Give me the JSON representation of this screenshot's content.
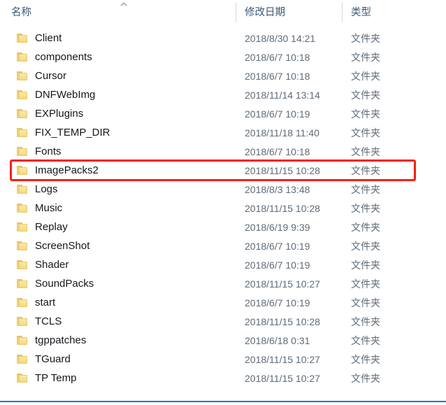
{
  "window": {
    "kind": "file-explorer-list-view"
  },
  "header": {
    "columns": [
      {
        "key": "name",
        "label": "名称"
      },
      {
        "key": "date",
        "label": "修改日期"
      },
      {
        "key": "type",
        "label": "类型"
      }
    ],
    "sort": {
      "column": "名称",
      "direction": "ascending",
      "indicator_glyph": "︿"
    }
  },
  "icons": {
    "folder": "folder-icon",
    "sort_ascending": "sort-ascending-icon"
  },
  "annotation": {
    "shape": "rectangle",
    "color": "#fa1e0e",
    "targets_row": "ImagePacks2"
  },
  "colors": {
    "header_text": "#3c5a78",
    "name_text": "#14181c",
    "meta_text": "#5f6b77",
    "folder_fill": "#f6dd8e",
    "annotation": "#fa1e0e",
    "bottom_rule": "#1578bf",
    "column_divider": "#d9d9d9"
  },
  "rows": [
    {
      "name": "Client",
      "date": "2018/8/30 14:21",
      "type": "文件夹",
      "icon": "folder-icon",
      "highlighted": false
    },
    {
      "name": "components",
      "date": "2018/6/7 10:18",
      "type": "文件夹",
      "icon": "folder-icon",
      "highlighted": false
    },
    {
      "name": "Cursor",
      "date": "2018/6/7 10:18",
      "type": "文件夹",
      "icon": "folder-icon",
      "highlighted": false
    },
    {
      "name": "DNFWebImg",
      "date": "2018/11/14 13:14",
      "type": "文件夹",
      "icon": "folder-icon",
      "highlighted": false
    },
    {
      "name": "EXPlugins",
      "date": "2018/6/7 10:19",
      "type": "文件夹",
      "icon": "folder-icon",
      "highlighted": false
    },
    {
      "name": "FIX_TEMP_DIR",
      "date": "2018/11/18 11:40",
      "type": "文件夹",
      "icon": "folder-icon",
      "highlighted": false
    },
    {
      "name": "Fonts",
      "date": "2018/6/7 10:18",
      "type": "文件夹",
      "icon": "folder-icon",
      "highlighted": false
    },
    {
      "name": "ImagePacks2",
      "date": "2018/11/15 10:28",
      "type": "文件夹",
      "icon": "folder-icon",
      "highlighted": true
    },
    {
      "name": "Logs",
      "date": "2018/8/3 13:48",
      "type": "文件夹",
      "icon": "folder-icon",
      "highlighted": false
    },
    {
      "name": "Music",
      "date": "2018/11/15 10:28",
      "type": "文件夹",
      "icon": "folder-icon",
      "highlighted": false
    },
    {
      "name": "Replay",
      "date": "2018/6/19 9:39",
      "type": "文件夹",
      "icon": "folder-icon",
      "highlighted": false
    },
    {
      "name": "ScreenShot",
      "date": "2018/6/7 10:19",
      "type": "文件夹",
      "icon": "folder-icon",
      "highlighted": false
    },
    {
      "name": "Shader",
      "date": "2018/6/7 10:19",
      "type": "文件夹",
      "icon": "folder-icon",
      "highlighted": false
    },
    {
      "name": "SoundPacks",
      "date": "2018/11/15 10:27",
      "type": "文件夹",
      "icon": "folder-icon",
      "highlighted": false
    },
    {
      "name": "start",
      "date": "2018/6/7 10:19",
      "type": "文件夹",
      "icon": "folder-icon",
      "highlighted": false
    },
    {
      "name": "TCLS",
      "date": "2018/11/15 10:28",
      "type": "文件夹",
      "icon": "folder-icon",
      "highlighted": false
    },
    {
      "name": "tgppatches",
      "date": "2018/6/18 0:31",
      "type": "文件夹",
      "icon": "folder-icon",
      "highlighted": false
    },
    {
      "name": "TGuard",
      "date": "2018/11/15 10:27",
      "type": "文件夹",
      "icon": "folder-icon",
      "highlighted": false
    },
    {
      "name": "TP Temp",
      "date": "2018/11/15 10:27",
      "type": "文件夹",
      "icon": "folder-icon",
      "highlighted": false
    }
  ]
}
